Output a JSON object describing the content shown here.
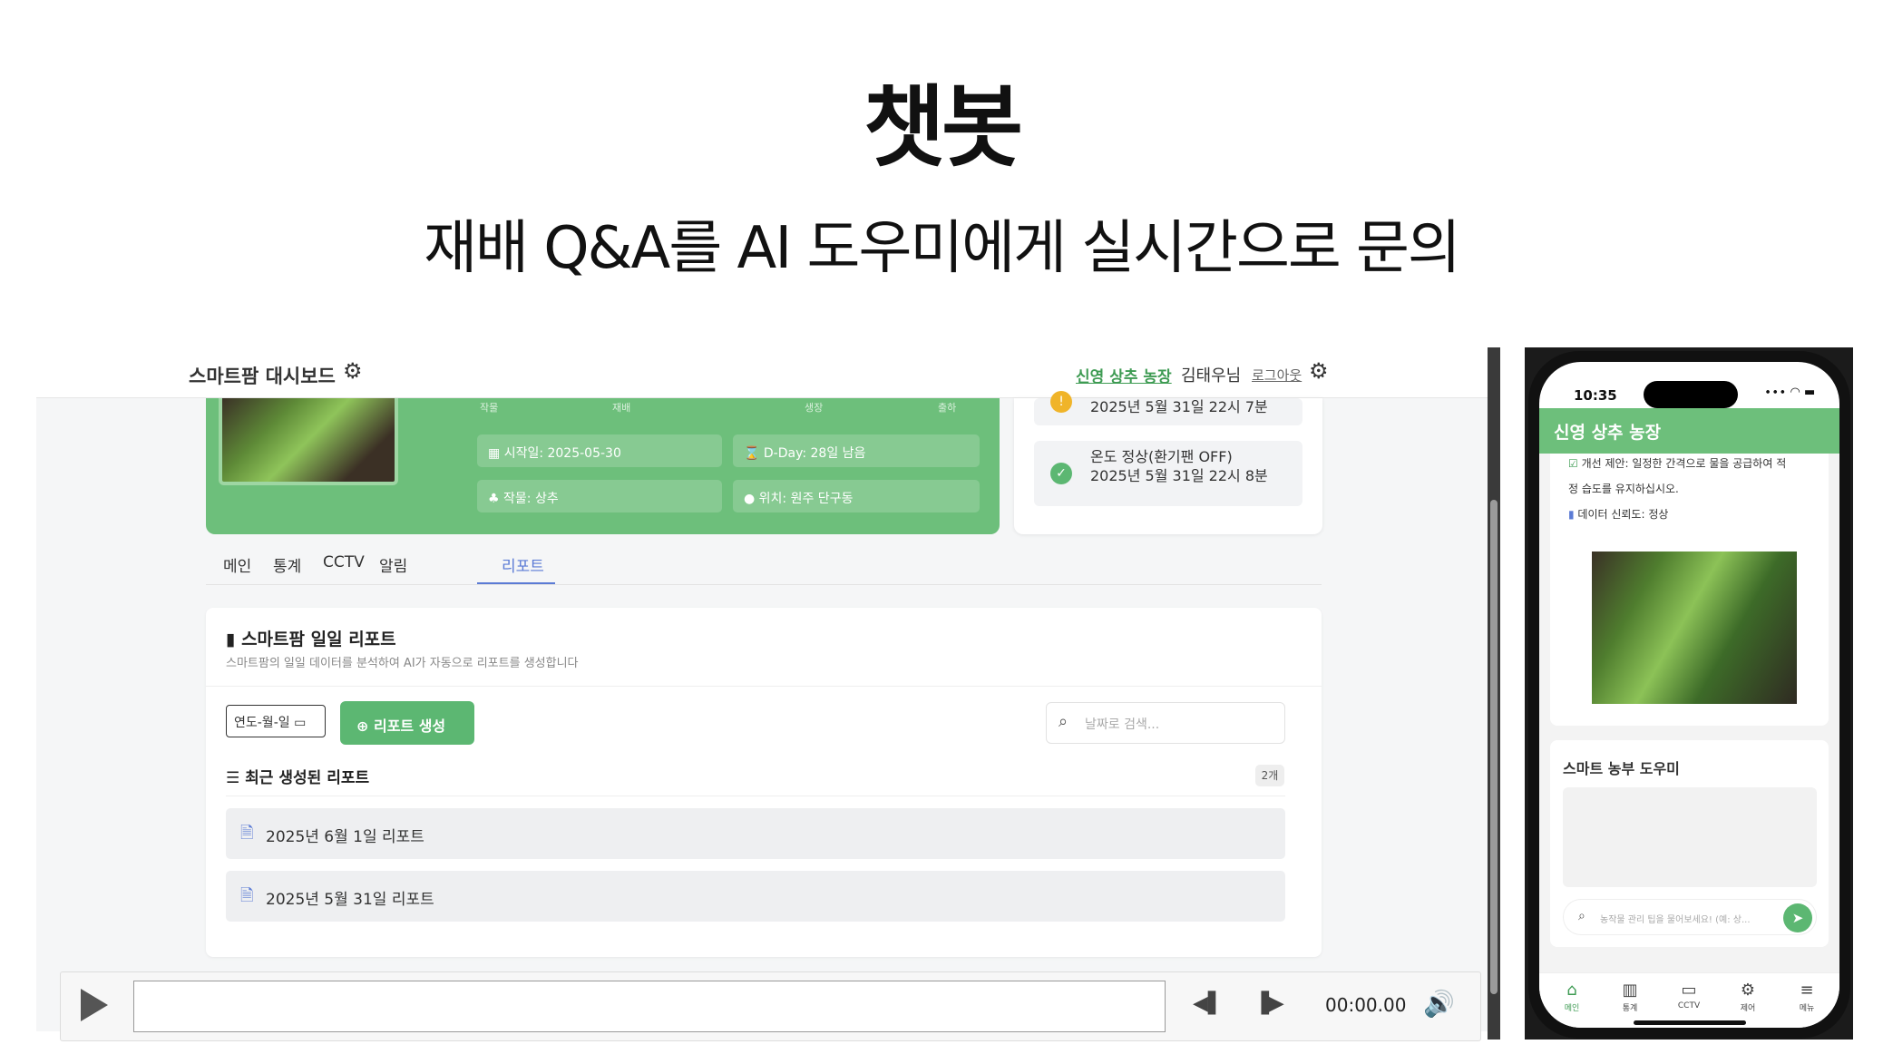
{
  "slide": {
    "title": "챗봇",
    "subtitle": "재배 Q&A를 AI 도우미에게 실시간으로 문의"
  },
  "dashboard": {
    "title": "스마트팜 대시보드",
    "farm_link": "신영 상추 농장",
    "user": "김태우님",
    "logout": "로그아웃",
    "info_headers": [
      "작물",
      "재배",
      "생장",
      "출하"
    ],
    "info_chips": {
      "start": "시작일: 2025-05-30",
      "dday": "D-Day: 28일 남음",
      "crop": "작물: 상추",
      "location": "위치: 원주 단구동"
    },
    "status": {
      "alert_time": "2025년 5월 31일 22시 7분",
      "ok_text": "온도 정상(환기팬 OFF)",
      "ok_time": "2025년 5월 31일 22시 8분"
    },
    "tabs": [
      "메인",
      "통계",
      "CCTV",
      "알림",
      "리포트"
    ],
    "report": {
      "title": "스마트팜 일일 리포트",
      "description": "스마트팜의 일일 데이터를 분석하여 AI가 자동으로 리포트를 생성합니다",
      "date_placeholder": "연도-월-일",
      "generate_label": "리포트 생성",
      "search_placeholder": "날짜로 검색...",
      "recent_title": "최근 생성된 리포트",
      "count": "2개",
      "items": [
        "2025년 6월 1일 리포트",
        "2025년 5월 31일 리포트"
      ]
    }
  },
  "media": {
    "time": "00:00.00"
  },
  "phone": {
    "clock": "10:35",
    "header": "신영 상추 농장",
    "tip1": "개선 제안: 일정한 간격으로 물을 공급하여 적",
    "tip2": "정 습도를 유지하십시오.",
    "tip3": "데이터 신뢰도: 정상",
    "helper_title": "스마트 농부 도우미",
    "input_placeholder": "농작물 관리 팁을 물어보세요! (예: 상...",
    "nav": [
      "메인",
      "통계",
      "CCTV",
      "제어",
      "메뉴"
    ]
  },
  "colors": {
    "brand_green": "#6dbf7b",
    "button_green": "#5cb772",
    "tab_active": "#5b7bd5"
  },
  "icons": [
    "gear-icon",
    "calendar-icon",
    "hourglass-icon",
    "seedling-icon",
    "location-icon",
    "warning-icon",
    "check-icon",
    "document-icon",
    "plus-icon",
    "search-icon",
    "list-icon",
    "play-icon",
    "prev-icon",
    "next-icon",
    "volume-icon",
    "send-icon",
    "home-icon",
    "chart-icon",
    "camera-icon",
    "settings-icon",
    "menu-icon"
  ]
}
